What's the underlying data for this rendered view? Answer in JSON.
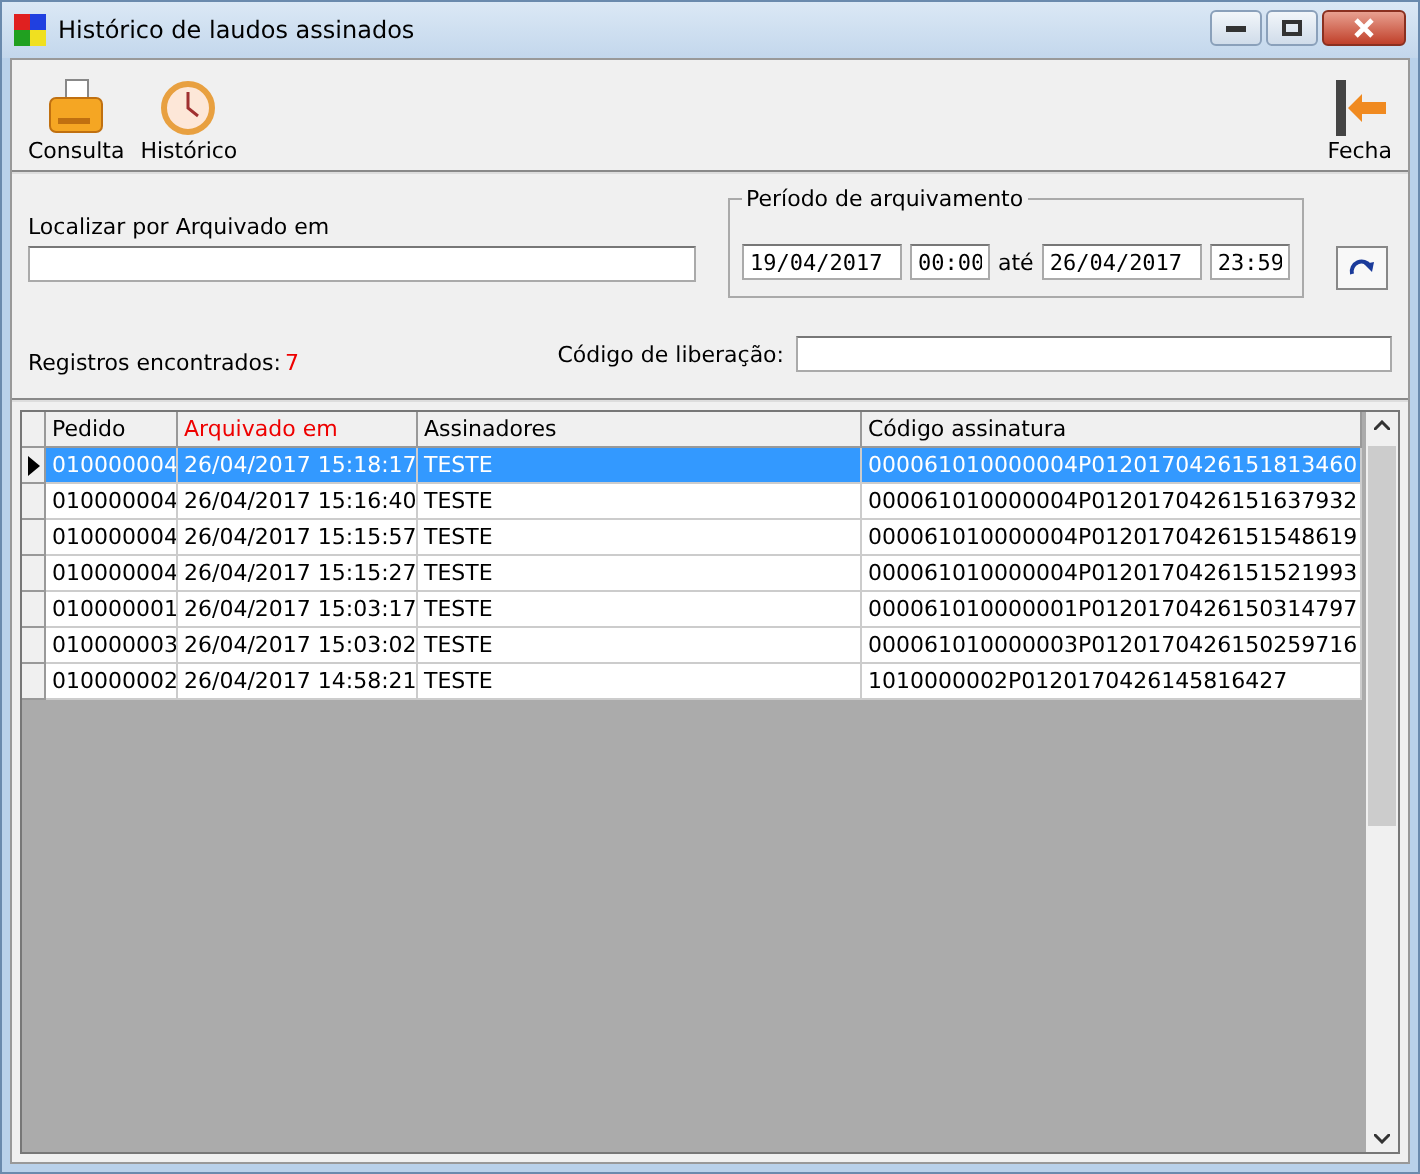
{
  "window": {
    "title": "Histórico de laudos assinados"
  },
  "toolbar": [
    {
      "label": "Consulta",
      "kind": "printer"
    },
    {
      "label": "Histórico",
      "kind": "clock"
    },
    {
      "label": "Fecha",
      "kind": "exit"
    }
  ],
  "filter": {
    "search_label": "Localizar por Arquivado em",
    "period_label": "Período de arquivamento",
    "date_from": "19/04/2017",
    "time_from": "00:00",
    "between": "até",
    "date_to": "26/04/2017",
    "time_to": "23:59",
    "count_label": "Registros encontrados:",
    "count": "7",
    "code_label": "Código de liberação:"
  },
  "table": {
    "columns": [
      {
        "label": "Pedido",
        "sorted": false
      },
      {
        "label": "Arquivado em",
        "sorted": true
      },
      {
        "label": "Assinadores",
        "sorted": false
      },
      {
        "label": "Código assinatura",
        "sorted": false
      }
    ],
    "rows": [
      {
        "selected": true,
        "cells": [
          "010000004",
          "26/04/2017 15:18:17",
          "TESTE",
          "000061010000004P0120170426151813460"
        ]
      },
      {
        "selected": false,
        "cells": [
          "010000004",
          "26/04/2017 15:16:40",
          "TESTE",
          "000061010000004P0120170426151637932"
        ]
      },
      {
        "selected": false,
        "cells": [
          "010000004",
          "26/04/2017 15:15:57",
          "TESTE",
          "000061010000004P0120170426151548619"
        ]
      },
      {
        "selected": false,
        "cells": [
          "010000004",
          "26/04/2017 15:15:27",
          "TESTE",
          "000061010000004P0120170426151521993"
        ]
      },
      {
        "selected": false,
        "cells": [
          "010000001",
          "26/04/2017 15:03:17",
          "TESTE",
          "000061010000001P0120170426150314797"
        ]
      },
      {
        "selected": false,
        "cells": [
          "010000003",
          "26/04/2017 15:03:02",
          "TESTE",
          "000061010000003P0120170426150259716"
        ]
      },
      {
        "selected": false,
        "cells": [
          "010000002",
          "26/04/2017 14:58:21",
          "TESTE",
          "1010000002P0120170426145816427"
        ]
      }
    ]
  }
}
